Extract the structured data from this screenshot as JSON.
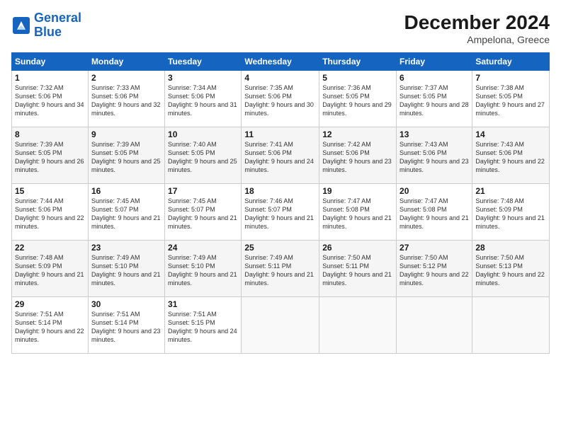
{
  "header": {
    "logo_line1": "General",
    "logo_line2": "Blue",
    "month_year": "December 2024",
    "location": "Ampelona, Greece"
  },
  "weekdays": [
    "Sunday",
    "Monday",
    "Tuesday",
    "Wednesday",
    "Thursday",
    "Friday",
    "Saturday"
  ],
  "weeks": [
    [
      {
        "day": "1",
        "sunrise": "Sunrise: 7:32 AM",
        "sunset": "Sunset: 5:06 PM",
        "daylight": "Daylight: 9 hours and 34 minutes."
      },
      {
        "day": "2",
        "sunrise": "Sunrise: 7:33 AM",
        "sunset": "Sunset: 5:06 PM",
        "daylight": "Daylight: 9 hours and 32 minutes."
      },
      {
        "day": "3",
        "sunrise": "Sunrise: 7:34 AM",
        "sunset": "Sunset: 5:06 PM",
        "daylight": "Daylight: 9 hours and 31 minutes."
      },
      {
        "day": "4",
        "sunrise": "Sunrise: 7:35 AM",
        "sunset": "Sunset: 5:06 PM",
        "daylight": "Daylight: 9 hours and 30 minutes."
      },
      {
        "day": "5",
        "sunrise": "Sunrise: 7:36 AM",
        "sunset": "Sunset: 5:05 PM",
        "daylight": "Daylight: 9 hours and 29 minutes."
      },
      {
        "day": "6",
        "sunrise": "Sunrise: 7:37 AM",
        "sunset": "Sunset: 5:05 PM",
        "daylight": "Daylight: 9 hours and 28 minutes."
      },
      {
        "day": "7",
        "sunrise": "Sunrise: 7:38 AM",
        "sunset": "Sunset: 5:05 PM",
        "daylight": "Daylight: 9 hours and 27 minutes."
      }
    ],
    [
      {
        "day": "8",
        "sunrise": "Sunrise: 7:39 AM",
        "sunset": "Sunset: 5:05 PM",
        "daylight": "Daylight: 9 hours and 26 minutes."
      },
      {
        "day": "9",
        "sunrise": "Sunrise: 7:39 AM",
        "sunset": "Sunset: 5:05 PM",
        "daylight": "Daylight: 9 hours and 25 minutes."
      },
      {
        "day": "10",
        "sunrise": "Sunrise: 7:40 AM",
        "sunset": "Sunset: 5:05 PM",
        "daylight": "Daylight: 9 hours and 25 minutes."
      },
      {
        "day": "11",
        "sunrise": "Sunrise: 7:41 AM",
        "sunset": "Sunset: 5:06 PM",
        "daylight": "Daylight: 9 hours and 24 minutes."
      },
      {
        "day": "12",
        "sunrise": "Sunrise: 7:42 AM",
        "sunset": "Sunset: 5:06 PM",
        "daylight": "Daylight: 9 hours and 23 minutes."
      },
      {
        "day": "13",
        "sunrise": "Sunrise: 7:43 AM",
        "sunset": "Sunset: 5:06 PM",
        "daylight": "Daylight: 9 hours and 23 minutes."
      },
      {
        "day": "14",
        "sunrise": "Sunrise: 7:43 AM",
        "sunset": "Sunset: 5:06 PM",
        "daylight": "Daylight: 9 hours and 22 minutes."
      }
    ],
    [
      {
        "day": "15",
        "sunrise": "Sunrise: 7:44 AM",
        "sunset": "Sunset: 5:06 PM",
        "daylight": "Daylight: 9 hours and 22 minutes."
      },
      {
        "day": "16",
        "sunrise": "Sunrise: 7:45 AM",
        "sunset": "Sunset: 5:07 PM",
        "daylight": "Daylight: 9 hours and 21 minutes."
      },
      {
        "day": "17",
        "sunrise": "Sunrise: 7:45 AM",
        "sunset": "Sunset: 5:07 PM",
        "daylight": "Daylight: 9 hours and 21 minutes."
      },
      {
        "day": "18",
        "sunrise": "Sunrise: 7:46 AM",
        "sunset": "Sunset: 5:07 PM",
        "daylight": "Daylight: 9 hours and 21 minutes."
      },
      {
        "day": "19",
        "sunrise": "Sunrise: 7:47 AM",
        "sunset": "Sunset: 5:08 PM",
        "daylight": "Daylight: 9 hours and 21 minutes."
      },
      {
        "day": "20",
        "sunrise": "Sunrise: 7:47 AM",
        "sunset": "Sunset: 5:08 PM",
        "daylight": "Daylight: 9 hours and 21 minutes."
      },
      {
        "day": "21",
        "sunrise": "Sunrise: 7:48 AM",
        "sunset": "Sunset: 5:09 PM",
        "daylight": "Daylight: 9 hours and 21 minutes."
      }
    ],
    [
      {
        "day": "22",
        "sunrise": "Sunrise: 7:48 AM",
        "sunset": "Sunset: 5:09 PM",
        "daylight": "Daylight: 9 hours and 21 minutes."
      },
      {
        "day": "23",
        "sunrise": "Sunrise: 7:49 AM",
        "sunset": "Sunset: 5:10 PM",
        "daylight": "Daylight: 9 hours and 21 minutes."
      },
      {
        "day": "24",
        "sunrise": "Sunrise: 7:49 AM",
        "sunset": "Sunset: 5:10 PM",
        "daylight": "Daylight: 9 hours and 21 minutes."
      },
      {
        "day": "25",
        "sunrise": "Sunrise: 7:49 AM",
        "sunset": "Sunset: 5:11 PM",
        "daylight": "Daylight: 9 hours and 21 minutes."
      },
      {
        "day": "26",
        "sunrise": "Sunrise: 7:50 AM",
        "sunset": "Sunset: 5:11 PM",
        "daylight": "Daylight: 9 hours and 21 minutes."
      },
      {
        "day": "27",
        "sunrise": "Sunrise: 7:50 AM",
        "sunset": "Sunset: 5:12 PM",
        "daylight": "Daylight: 9 hours and 22 minutes."
      },
      {
        "day": "28",
        "sunrise": "Sunrise: 7:50 AM",
        "sunset": "Sunset: 5:13 PM",
        "daylight": "Daylight: 9 hours and 22 minutes."
      }
    ],
    [
      {
        "day": "29",
        "sunrise": "Sunrise: 7:51 AM",
        "sunset": "Sunset: 5:14 PM",
        "daylight": "Daylight: 9 hours and 22 minutes."
      },
      {
        "day": "30",
        "sunrise": "Sunrise: 7:51 AM",
        "sunset": "Sunset: 5:14 PM",
        "daylight": "Daylight: 9 hours and 23 minutes."
      },
      {
        "day": "31",
        "sunrise": "Sunrise: 7:51 AM",
        "sunset": "Sunset: 5:15 PM",
        "daylight": "Daylight: 9 hours and 24 minutes."
      },
      null,
      null,
      null,
      null
    ]
  ]
}
